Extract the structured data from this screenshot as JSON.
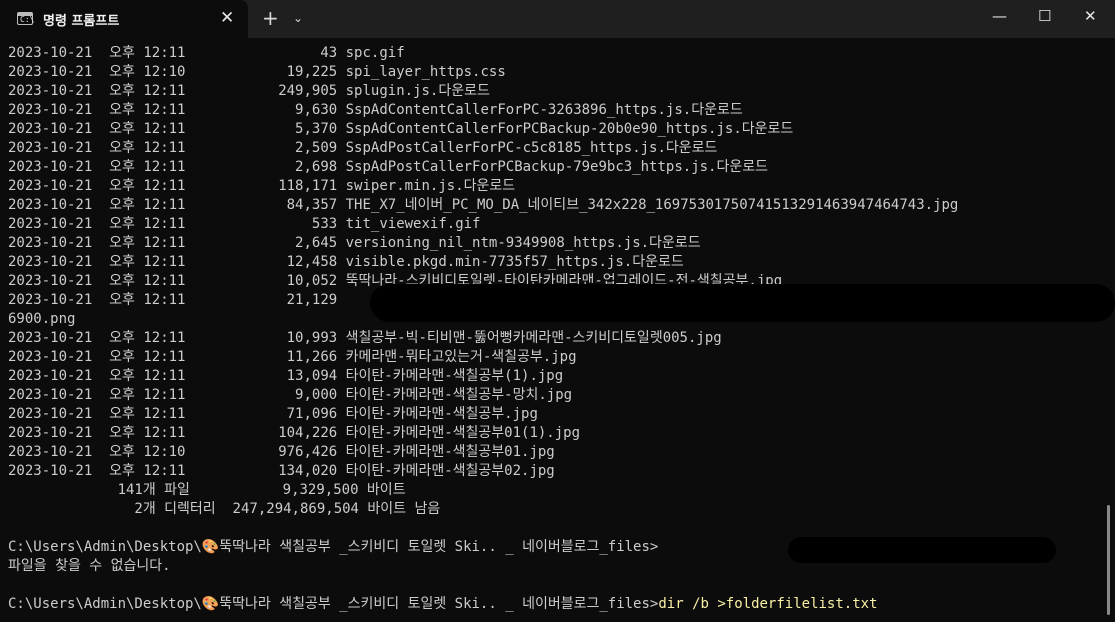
{
  "window": {
    "tab_title": "명령 프롬프트",
    "tab_icon_glyph": "C:\\",
    "close_tab_glyph": "✕",
    "new_tab_glyph": "+",
    "dropdown_glyph": "⌄",
    "minimize_glyph": "—",
    "maximize_glyph": "☐",
    "close_glyph": "✕"
  },
  "colors": {
    "background": "#0c0c0c",
    "text": "#cccccc",
    "typed_command": "#f9f1a5",
    "titlebar": "#1f1f1f"
  },
  "terminal": {
    "listing": [
      "2023-10-21  오후 12:11                43 spc.gif",
      "2023-10-21  오후 12:10            19,225 spi_layer_https.css",
      "2023-10-21  오후 12:11           249,905 splugin.js.다운로드",
      "2023-10-21  오후 12:11             9,630 SspAdContentCallerForPC-3263896_https.js.다운로드",
      "2023-10-21  오후 12:11             5,370 SspAdContentCallerForPCBackup-20b0e90_https.js.다운로드",
      "2023-10-21  오후 12:11             2,509 SspAdPostCallerForPC-c5c8185_https.js.다운로드",
      "2023-10-21  오후 12:11             2,698 SspAdPostCallerForPCBackup-79e9bc3_https.js.다운로드",
      "2023-10-21  오후 12:11           118,171 swiper.min.js.다운로드",
      "2023-10-21  오후 12:11            84,357 THE_X7_네이버_PC_MO_DA_네이티브_342x228_16975301750741513291463947464743.jpg",
      "2023-10-21  오후 12:11               533 tit_viewexif.gif",
      "2023-10-21  오후 12:11             2,645 versioning_nil_ntm-9349908_https.js.다운로드",
      "2023-10-21  오후 12:11            12,458 visible.pkgd.min-7735f57_https.js.다운로드",
      "2023-10-21  오후 12:11            10,052 뚝딱나라-스키비디토일렛-타이탄카메라맨-업그레이드-전-색칠공부.jpg",
      "2023-10-21  오후 12:11            21,129",
      "6900.png",
      "2023-10-21  오후 12:11            10,993 색칠공부-빅-티비맨-뚫어뻥카메라맨-스키비디토일렛005.jpg",
      "2023-10-21  오후 12:11            11,266 카메라맨-뭐타고있는거-색칠공부.jpg",
      "2023-10-21  오후 12:11            13,094 타이탄-카메라맨-색칠공부(1).jpg",
      "2023-10-21  오후 12:11             9,000 타이탄-카메라맨-색칠공부-망치.jpg",
      "2023-10-21  오후 12:11            71,096 타이탄-카메라맨-색칠공부.jpg",
      "2023-10-21  오후 12:11           104,226 타이탄-카메라맨-색칠공부01(1).jpg",
      "2023-10-21  오후 12:10           976,426 타이탄-카메라맨-색칠공부01.jpg",
      "2023-10-21  오후 12:11           134,020 타이탄-카메라맨-색칠공부02.jpg"
    ],
    "summary_files": "             141개 파일           9,329,500 바이트",
    "summary_dirs": "               2개 디렉터리  247,294,869,504 바이트 남음",
    "prompt1": "C:\\Users\\Admin\\Desktop\\🎨뚝딱나라 색칠공부 _스키비디 토일렛 Ski.. _ 네이버블로그_files>",
    "error_msg": "파일을 찾을 수 없습니다.",
    "prompt2": "C:\\Users\\Admin\\Desktop\\🎨뚝딱나라 색칠공부 _스키비디 토일렛 Ski.. _ 네이버블로그_files>",
    "command": "dir /b >folderfilelist.txt"
  }
}
